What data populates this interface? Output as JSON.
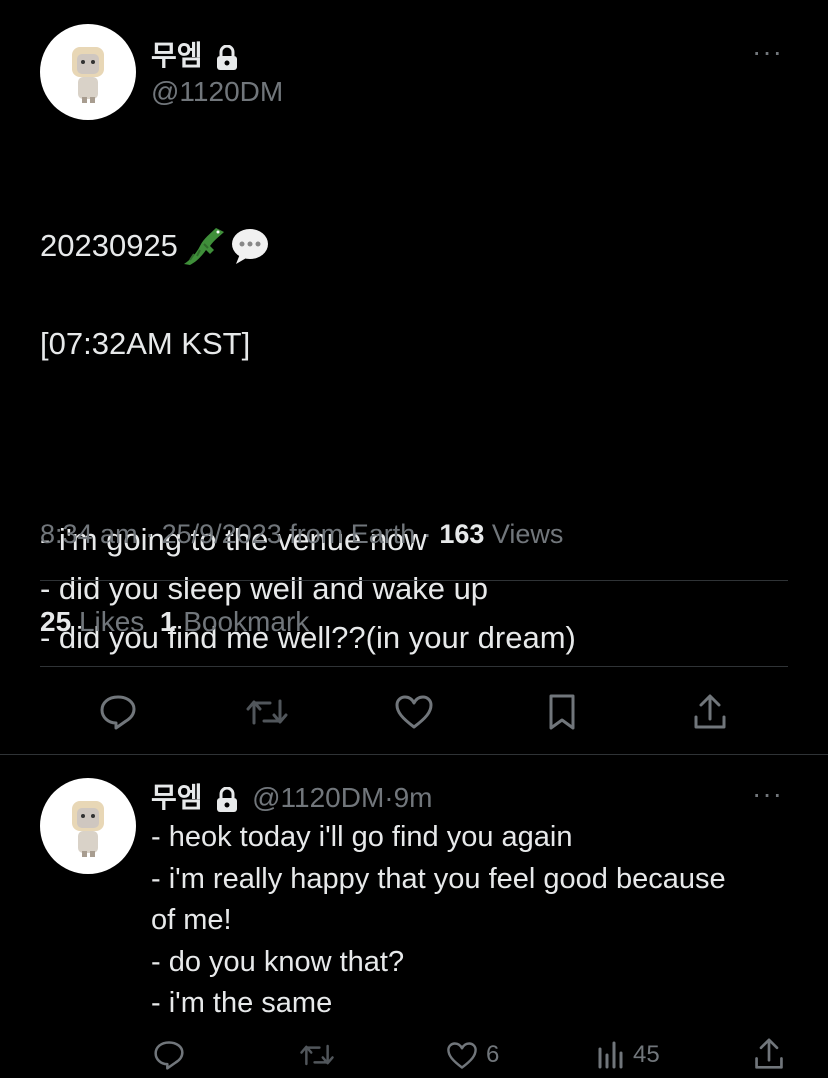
{
  "tweet": {
    "author": {
      "display_name": "무엠",
      "handle": "@1120DM"
    },
    "text_line1": "20230925",
    "text_line2": "[07:32AM KST]",
    "text_body": "- i'm going to the venue now\n- did you sleep well and wake up\n- did you find me well??(in your dream)",
    "time": "8:34 am",
    "date": "25/9/2023",
    "source": "from Earth",
    "views_count": "163",
    "views_label": "Views",
    "likes_count": "25",
    "likes_label": "Likes",
    "bookmarks_count": "1",
    "bookmarks_label": "Bookmark",
    "emojis": [
      "crocodile-emoji",
      "speech-bubble-emoji"
    ]
  },
  "reply": {
    "author": {
      "display_name": "무엠",
      "handle": "@1120DM",
      "age": "9m"
    },
    "text": "- heok today i'll go find you again\n- i'm really happy that you feel good because\nof me!\n- do you know that?\n- i'm the same",
    "likes": "6",
    "views": "45"
  },
  "colors": {
    "background": "#000000",
    "text": "#e7e9ea",
    "secondary": "#71767b",
    "divider": "#2f3336"
  },
  "separator": "·",
  "more_label": "···"
}
